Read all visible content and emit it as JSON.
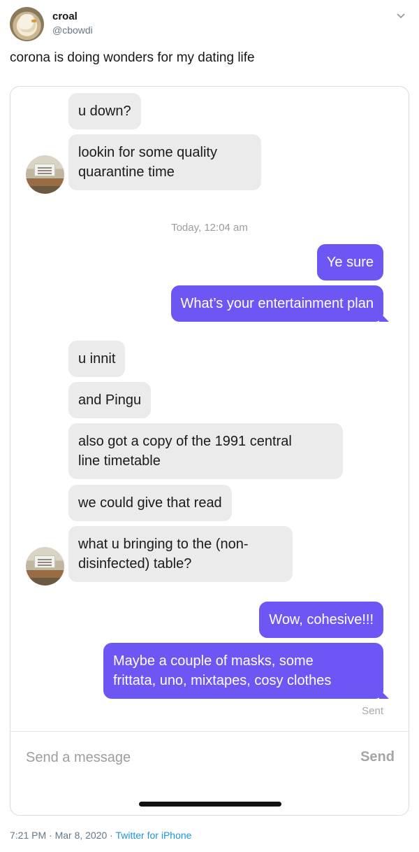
{
  "tweet": {
    "author_name": "croal",
    "author_handle": "@cbowdi",
    "text": "corona is doing wonders for my dating life",
    "time": "7:21 PM · Mar 8, 2020 · ",
    "source": "Twitter for iPhone"
  },
  "conversation": {
    "messages": [
      {
        "from": "them",
        "text": "u down?"
      },
      {
        "from": "them",
        "text": "lookin for some quality\nquarantine time"
      },
      {
        "from": "me",
        "text": "Ye sure"
      },
      {
        "from": "me",
        "text": "What’s your entertainment plan"
      },
      {
        "from": "them",
        "text": "u innit"
      },
      {
        "from": "them",
        "text": "and Pingu"
      },
      {
        "from": "them",
        "text": "also got a copy of the 1991 central\nline timetable"
      },
      {
        "from": "them",
        "text": "we could give that read"
      },
      {
        "from": "them",
        "text": "what u bringing to the (non-\ndisinfected) table?"
      },
      {
        "from": "me",
        "text": "Wow, cohesive!!!"
      },
      {
        "from": "me",
        "text": "Maybe a couple of masks, some\nfrittata, uno, mixtapes, cosy clothes"
      }
    ],
    "timestamp": "Today, 12:04 am",
    "status": "Sent"
  },
  "composer": {
    "placeholder": "Send a message",
    "send_label": "Send"
  },
  "colors": {
    "outgoing_bubble": "#6c57f5",
    "incoming_bubble": "#ebebeb",
    "link": "#1b95e0"
  },
  "icons": {
    "menu": "chevron-down-icon"
  }
}
